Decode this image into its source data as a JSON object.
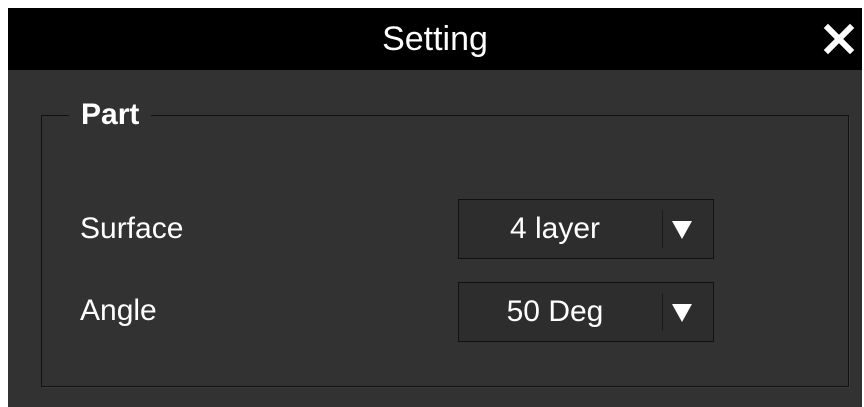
{
  "window": {
    "title": "Setting",
    "close_icon": "close-icon"
  },
  "group": {
    "legend": "Part",
    "rows": [
      {
        "label": "Surface",
        "value": "4 layer",
        "icon": "dropdown-arrow-icon"
      },
      {
        "label": "Angle",
        "value": "50 Deg",
        "icon": "dropdown-arrow-icon"
      }
    ]
  },
  "colors": {
    "titlebar": "#000000",
    "panel": "#323232",
    "text": "#ffffff",
    "border": "#111111"
  }
}
